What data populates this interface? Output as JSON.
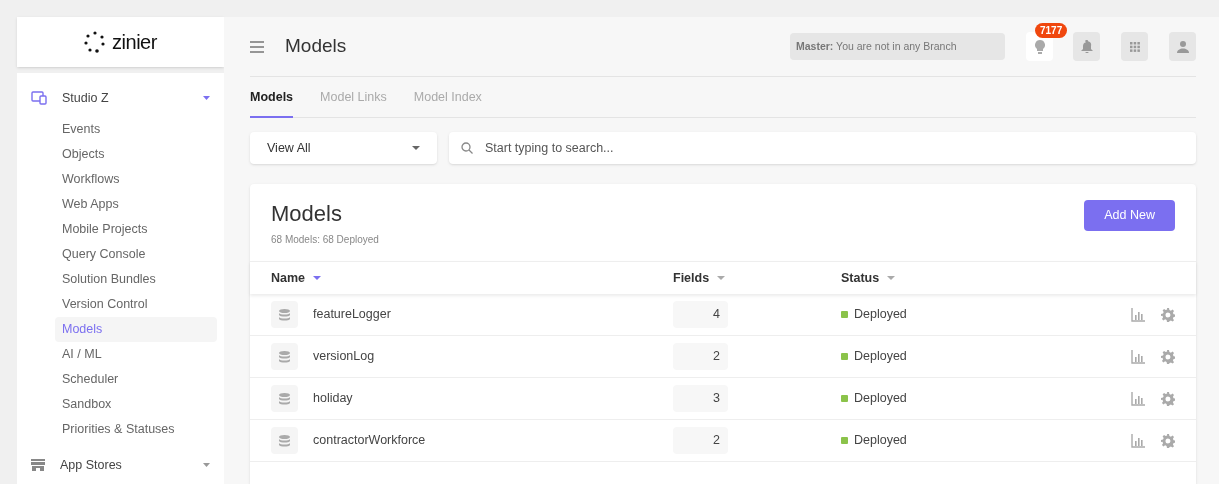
{
  "sidebar": {
    "logo": "zinier",
    "sections": [
      {
        "label": "Studio Z",
        "expanded": true,
        "items": [
          {
            "label": "Events",
            "selected": false
          },
          {
            "label": "Objects",
            "selected": false
          },
          {
            "label": "Workflows",
            "selected": false
          },
          {
            "label": "Web Apps",
            "selected": false
          },
          {
            "label": "Mobile Projects",
            "selected": false
          },
          {
            "label": "Query Console",
            "selected": false
          },
          {
            "label": "Solution Bundles",
            "selected": false
          },
          {
            "label": "Version Control",
            "selected": false
          },
          {
            "label": "Models",
            "selected": true
          },
          {
            "label": "AI / ML",
            "selected": false
          },
          {
            "label": "Scheduler",
            "selected": false
          },
          {
            "label": "Sandbox",
            "selected": false
          },
          {
            "label": "Priorities & Statuses",
            "selected": false
          }
        ]
      },
      {
        "label": "App Stores",
        "expanded": false
      }
    ]
  },
  "header": {
    "title": "Models",
    "branch": "**Master:** You are not in any Branch",
    "notification_count": "7177"
  },
  "tabs": [
    {
      "label": "Models",
      "selected": true
    },
    {
      "label": "Model Links",
      "selected": false
    },
    {
      "label": "Model Index",
      "selected": false
    }
  ],
  "filter": {
    "value": "View All"
  },
  "search": {
    "placeholder": "Start typing to search..."
  },
  "card": {
    "title": "Models",
    "subtitle": "68 Models: 68 Deployed",
    "add_button": "Add New"
  },
  "table": {
    "columns": [
      {
        "label": "Name",
        "sorted": true
      },
      {
        "label": "Fields",
        "sorted": false
      },
      {
        "label": "Status",
        "sorted": false
      }
    ],
    "rows": [
      {
        "name": "featureLogger",
        "fields": "4",
        "status": "Deployed",
        "color": "#8bc34a"
      },
      {
        "name": "versionLog",
        "fields": "2",
        "status": "Deployed",
        "color": "#8bc34a"
      },
      {
        "name": "holiday",
        "fields": "3",
        "status": "Deployed",
        "color": "#8bc34a"
      },
      {
        "name": "contractorWorkforce",
        "fields": "2",
        "status": "Deployed",
        "color": "#8bc34a"
      }
    ]
  }
}
